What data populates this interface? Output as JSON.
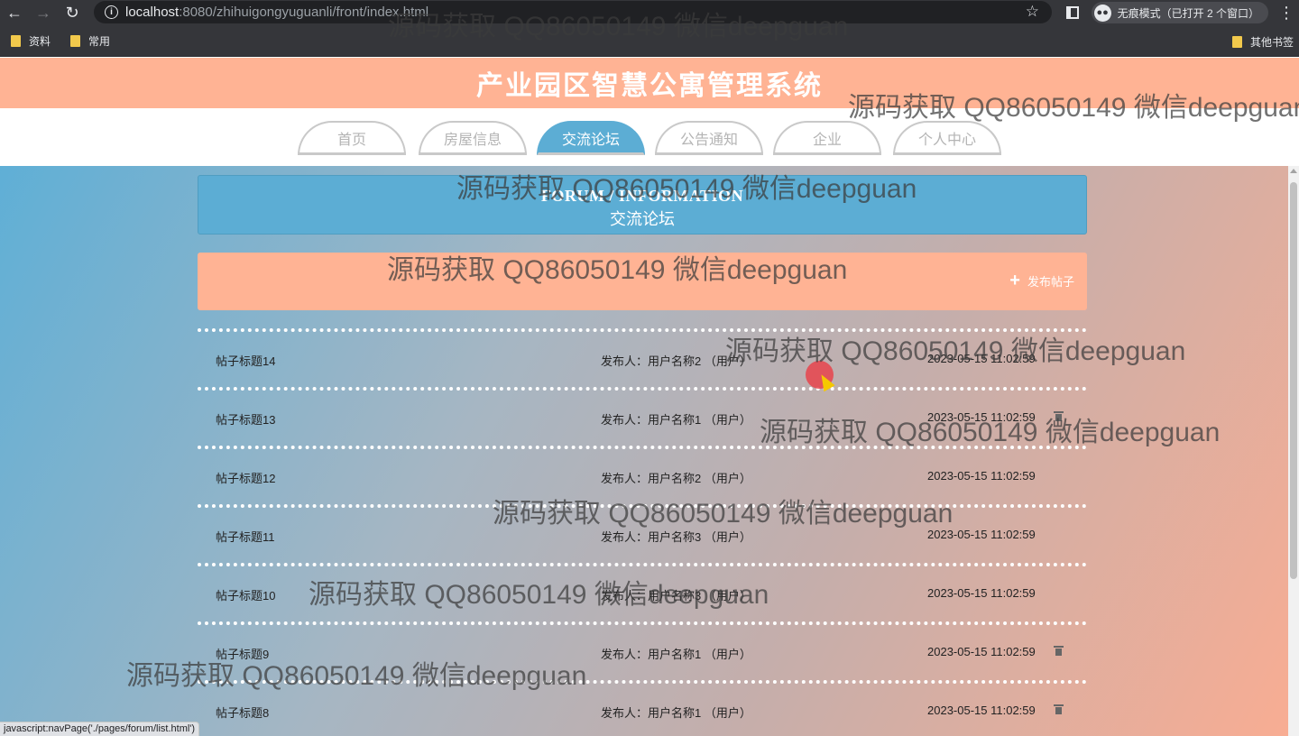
{
  "browser": {
    "url_host": "localhost",
    "url_path": ":8080/zhihuigongyuguanli/front/index.html",
    "incognito_label": "无痕模式（已打开 2 个窗口）",
    "bookmarks": [
      "资料",
      "常用"
    ],
    "other_bookmarks": "其他书签",
    "status_text": "javascript:navPage('./pages/forum/list.html')"
  },
  "site": {
    "title": "产业园区智慧公寓管理系统",
    "nav": [
      {
        "label": "首页",
        "active": false
      },
      {
        "label": "房屋信息",
        "active": false
      },
      {
        "label": "交流论坛",
        "active": true
      },
      {
        "label": "公告通知",
        "active": false
      },
      {
        "label": "企业",
        "active": false
      },
      {
        "label": "个人中心",
        "active": false
      }
    ]
  },
  "banner": {
    "en": "FORUM / INFORMATION",
    "cn": "交流论坛"
  },
  "actions": {
    "publish_label": "发布帖子"
  },
  "posts": [
    {
      "title": "帖子标题14",
      "author": "发布人：用户名称2 （用户）",
      "time": "2023-05-15 11:02:59",
      "deletable": false
    },
    {
      "title": "帖子标题13",
      "author": "发布人：用户名称1 （用户）",
      "time": "2023-05-15 11:02:59",
      "deletable": true
    },
    {
      "title": "帖子标题12",
      "author": "发布人：用户名称2 （用户）",
      "time": "2023-05-15 11:02:59",
      "deletable": false
    },
    {
      "title": "帖子标题11",
      "author": "发布人：用户名称3 （用户）",
      "time": "2023-05-15 11:02:59",
      "deletable": false
    },
    {
      "title": "帖子标题10",
      "author": "发布人：用户名称3 （用户）",
      "time": "2023-05-15 11:02:59",
      "deletable": false
    },
    {
      "title": "帖子标题9",
      "author": "发布人：用户名称1 （用户）",
      "time": "2023-05-15 11:02:59",
      "deletable": true
    },
    {
      "title": "帖子标题8",
      "author": "发布人：用户名称1 （用户）",
      "time": "2023-05-15 11:02:59",
      "deletable": true
    }
  ],
  "watermark": {
    "text": "源码获取 QQ86050149 微信deepguan"
  },
  "colors": {
    "header_bg": "#ffb394",
    "accent_blue": "#5cadd4"
  }
}
